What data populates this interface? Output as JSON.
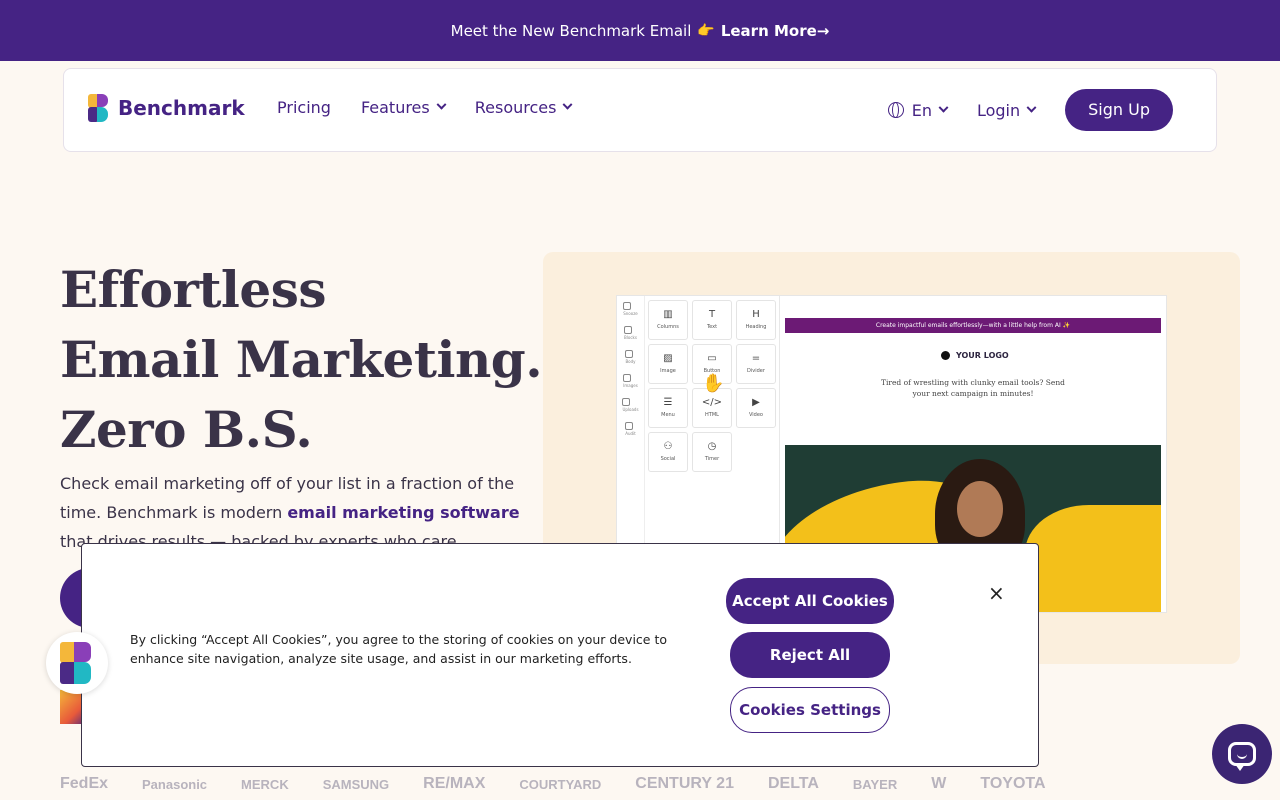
{
  "announcement": {
    "text": "Meet the New Benchmark Email",
    "emoji": "👉",
    "link_label": "Learn More",
    "arrow": "→"
  },
  "nav": {
    "logo_text": "Benchmark",
    "links": [
      {
        "label": "Pricing"
      },
      {
        "label": "Features"
      },
      {
        "label": "Resources"
      }
    ],
    "language": "En",
    "login": "Login",
    "signup": "Sign Up"
  },
  "hero": {
    "title_line1": "Effortless",
    "title_line2": "Email Marketing.",
    "title_line3": "Zero B.S.",
    "sub_part1": "Check email marketing off of your list in a fraction of the time. Benchmark is modern ",
    "sub_link": "email marketing software",
    "sub_part2": " that drives results — backed by experts who care."
  },
  "editor": {
    "rail": [
      "Snooze",
      "Blocks",
      "Body",
      "Images",
      "Uploads",
      "Audit"
    ],
    "blocks": [
      {
        "icon": "▥",
        "label": "Columns"
      },
      {
        "icon": "T",
        "label": "Text"
      },
      {
        "icon": "H",
        "label": "Heading"
      },
      {
        "icon": "▨",
        "label": "Image"
      },
      {
        "icon": "▭",
        "label": "Button"
      },
      {
        "icon": "=",
        "label": "Divider"
      },
      {
        "icon": "☰",
        "label": "Menu"
      },
      {
        "icon": "</>",
        "label": "HTML"
      },
      {
        "icon": "▶",
        "label": "Video"
      },
      {
        "icon": "⚇",
        "label": "Social"
      },
      {
        "icon": "◷",
        "label": "Timer"
      }
    ],
    "banner": "Create impactful emails effortlessly—with a little help from AI ✨",
    "your_logo": "YOUR LOGO",
    "body_text": "Tired of wrestling with clunky email tools? Send your next campaign in minutes!"
  },
  "cookie": {
    "text": "By clicking “Accept All Cookies”, you agree to the storing of cookies on your device to enhance site navigation, analyze site usage, and assist in our marketing efforts.",
    "accept": "Accept All Cookies",
    "reject": "Reject All",
    "settings": "Cookies Settings",
    "close": "×"
  },
  "brands": [
    "FedEx",
    "Panasonic",
    "MERCK",
    "SAMSUNG",
    "RE/MAX",
    "COURTYARD",
    "CENTURY 21",
    "DELTA",
    "BAYER",
    "W",
    "TOYOTA"
  ],
  "colors": {
    "brand_purple": "#452384",
    "background": "#fdf8f2",
    "hero_card": "#fbefdd"
  }
}
